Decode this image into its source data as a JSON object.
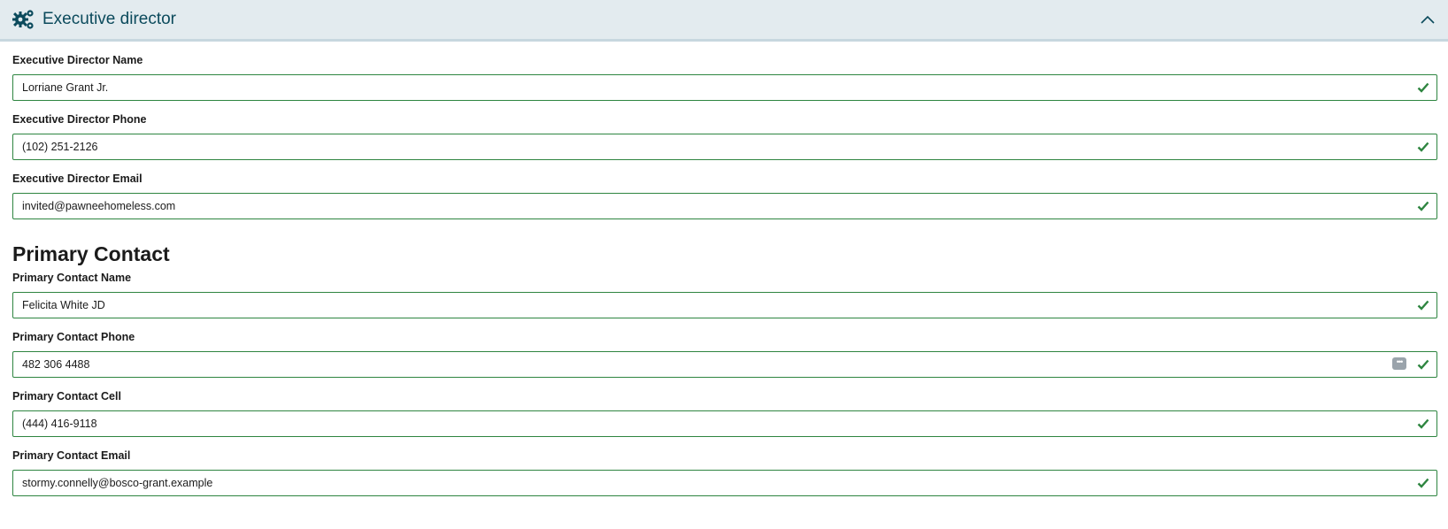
{
  "header": {
    "title": "Executive director",
    "icon": "gears-icon",
    "collapse_icon": "chevron-up-icon",
    "accent": "#0b4a5c"
  },
  "colors": {
    "valid_border": "#2e8540",
    "check": "#2e8540",
    "header_bg": "#e3ebef"
  },
  "executive": [
    {
      "label": "Executive Director Name",
      "value": "Lorriane Grant Jr."
    },
    {
      "label": "Executive Director Phone",
      "value": "(102) 251-2126"
    },
    {
      "label": "Executive Director Email",
      "value": "invited@pawneehomeless.com"
    }
  ],
  "primary_contact": {
    "title": "Primary Contact",
    "fields": [
      {
        "label": "Primary Contact Name",
        "value": "Felicita White JD"
      },
      {
        "label": "Primary Contact Phone",
        "value": "482 306 4488"
      },
      {
        "label": "Primary Contact Cell",
        "value": "(444) 416-9118"
      },
      {
        "label": "Primary Contact Email",
        "value": "stormy.connelly@bosco-grant.example"
      }
    ]
  }
}
